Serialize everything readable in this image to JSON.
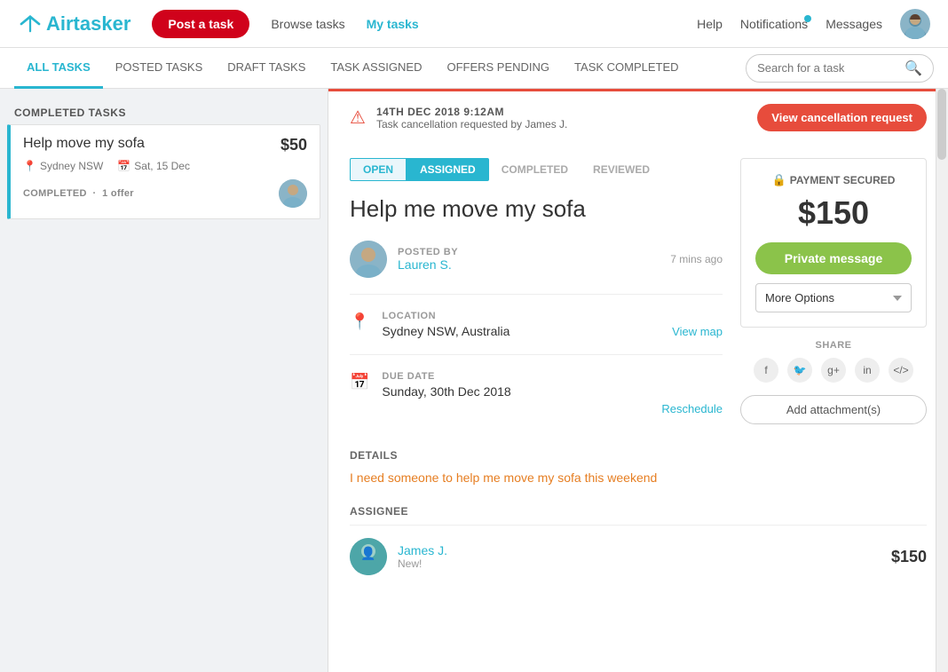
{
  "navbar": {
    "logo_text": "Airtasker",
    "post_task_label": "Post a task",
    "browse_tasks_label": "Browse tasks",
    "my_tasks_label": "My tasks",
    "help_label": "Help",
    "notifications_label": "Notifications",
    "messages_label": "Messages"
  },
  "tabs": {
    "items": [
      {
        "id": "all",
        "label": "ALL TASKS",
        "active": true
      },
      {
        "id": "posted",
        "label": "POSTED TASKS",
        "active": false
      },
      {
        "id": "draft",
        "label": "DRAFT TASKS",
        "active": false
      },
      {
        "id": "assigned",
        "label": "TASK ASSIGNED",
        "active": false
      },
      {
        "id": "offers",
        "label": "OFFERS PENDING",
        "active": false
      },
      {
        "id": "completed",
        "label": "TASK COMPLETED",
        "active": false
      }
    ],
    "search_placeholder": "Search for a task"
  },
  "sidebar": {
    "section_title": "COMPLETED TASKS",
    "tasks": [
      {
        "title": "Help move my sofa",
        "price": "$50",
        "location": "Sydney NSW",
        "date": "Sat, 15 Dec",
        "status": "COMPLETED",
        "offers": "1 offer",
        "active": true
      }
    ]
  },
  "detail": {
    "cancellation": {
      "datetime": "14TH DEC 2018 9:12AM",
      "message": "Task cancellation requested by James J.",
      "button_label": "View cancellation request"
    },
    "status_pills": [
      {
        "label": "OPEN",
        "state": "open"
      },
      {
        "label": "ASSIGNED",
        "state": "assigned"
      },
      {
        "label": "COMPLETED",
        "state": "inactive"
      },
      {
        "label": "REVIEWED",
        "state": "inactive"
      }
    ],
    "title": "Help me move my sofa",
    "posted_by": {
      "label": "POSTED BY",
      "name": "Lauren S.",
      "time_ago": "7 mins ago"
    },
    "location": {
      "label": "LOCATION",
      "value": "Sydney NSW, Australia",
      "view_map": "View map"
    },
    "due_date": {
      "label": "DUE DATE",
      "value": "Sunday, 30th Dec 2018",
      "reschedule": "Reschedule"
    },
    "details": {
      "label": "DETAILS",
      "text": "I need someone to help me move my sofa this weekend"
    },
    "assignee": {
      "label": "ASSIGNEE",
      "name": "James J.",
      "badge": "New!",
      "price": "$150"
    }
  },
  "payment": {
    "secured_label": "PAYMENT SECURED",
    "amount": "$150",
    "private_message_label": "Private message",
    "more_options_label": "More Options",
    "share_label": "SHARE",
    "add_attachment_label": "Add attachment(s)"
  }
}
